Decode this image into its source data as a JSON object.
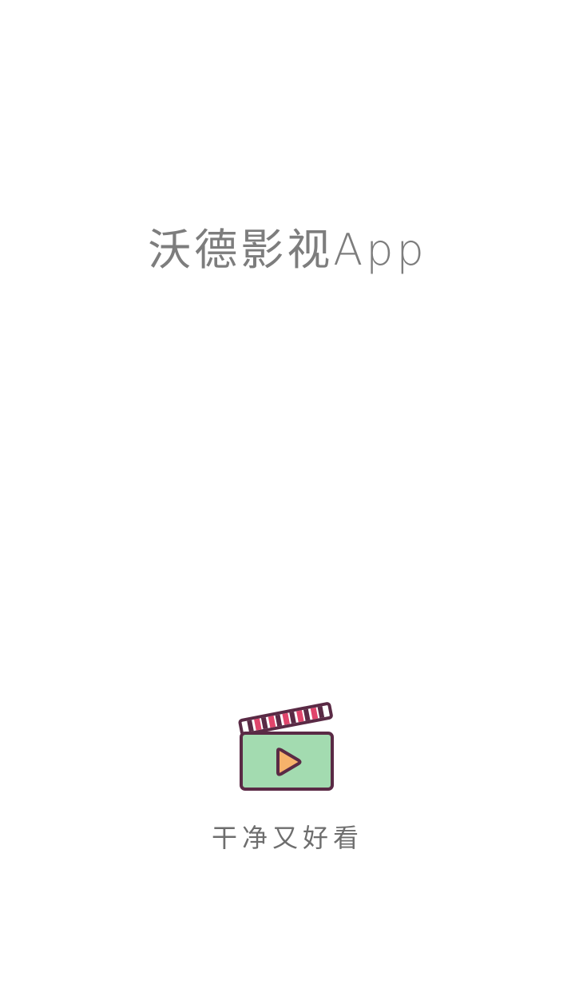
{
  "splash": {
    "app_title": "沃德影视App",
    "slogan": "干净又好看",
    "logo_icon": "clapperboard-play-icon"
  },
  "colors": {
    "background": "#ffffff",
    "title_text": "#7d7d7d",
    "slogan_text": "#6e6e6e",
    "logo_outline": "#5a2a45",
    "logo_screen": "#a3dbb0",
    "logo_play": "#f6b26b",
    "logo_stripe_accent": "#e0456c"
  }
}
